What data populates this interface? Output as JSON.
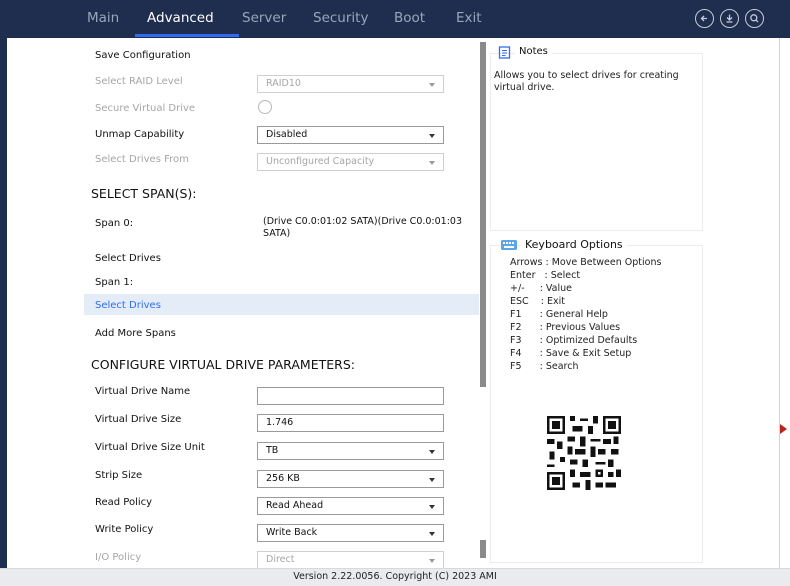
{
  "topbar": {
    "tabs": [
      "Main",
      "Advanced",
      "Server",
      "Security",
      "Boot",
      "Exit"
    ],
    "active_tab": "Advanced",
    "icons": [
      "back-icon",
      "download-icon",
      "search-icon"
    ],
    "colors": {
      "background": "#1f2d4e",
      "accent": "#2f6df0"
    }
  },
  "form": {
    "save_configuration": "Save Configuration",
    "select_raid_level": {
      "label": "Select RAID Level",
      "value": "RAID10"
    },
    "secure_virtual_drive": {
      "label": "Secure Virtual Drive"
    },
    "unmap_capability": {
      "label": "Unmap Capability",
      "value": "Disabled"
    },
    "select_drives_from": {
      "label": "Select Drives From",
      "value": "Unconfigured Capacity"
    },
    "section_spans": "SELECT SPAN(S):",
    "span0": {
      "label": "Span 0:",
      "value": "(Drive C0.0:01:02 SATA)(Drive C0.0:01:03 SATA)"
    },
    "select_drives_1": "Select Drives",
    "span1": {
      "label": "Span 1:"
    },
    "select_drives_2": "Select Drives",
    "add_more_spans": "Add More Spans",
    "section_params": "CONFIGURE VIRTUAL DRIVE PARAMETERS:",
    "virtual_drive_name": {
      "label": "Virtual Drive Name",
      "value": ""
    },
    "virtual_drive_size": {
      "label": "Virtual Drive Size",
      "value": "1.746"
    },
    "virtual_drive_size_unit": {
      "label": "Virtual Drive Size Unit",
      "value": "TB"
    },
    "strip_size": {
      "label": "Strip Size",
      "value": "256 KB"
    },
    "read_policy": {
      "label": "Read Policy",
      "value": "Read Ahead"
    },
    "write_policy": {
      "label": "Write Policy",
      "value": "Write Back"
    },
    "io_policy": {
      "label": "I/O Policy",
      "value": "Direct"
    }
  },
  "notes": {
    "title": "Notes",
    "text": "Allows you to select drives for creating virtual drive."
  },
  "keyboard": {
    "title": "Keyboard Options",
    "rows": [
      "Arrows : Move Between Options",
      "Enter   : Select",
      "+/-     : Value",
      "ESC    : Exit",
      "F1      : General Help",
      "F2      : Previous Values",
      "F3      : Optimized Defaults",
      "F4      : Save & Exit Setup",
      "F5      : Search"
    ]
  },
  "footer": {
    "text": "Version 2.22.0056. Copyright (C) 2023 AMI"
  }
}
